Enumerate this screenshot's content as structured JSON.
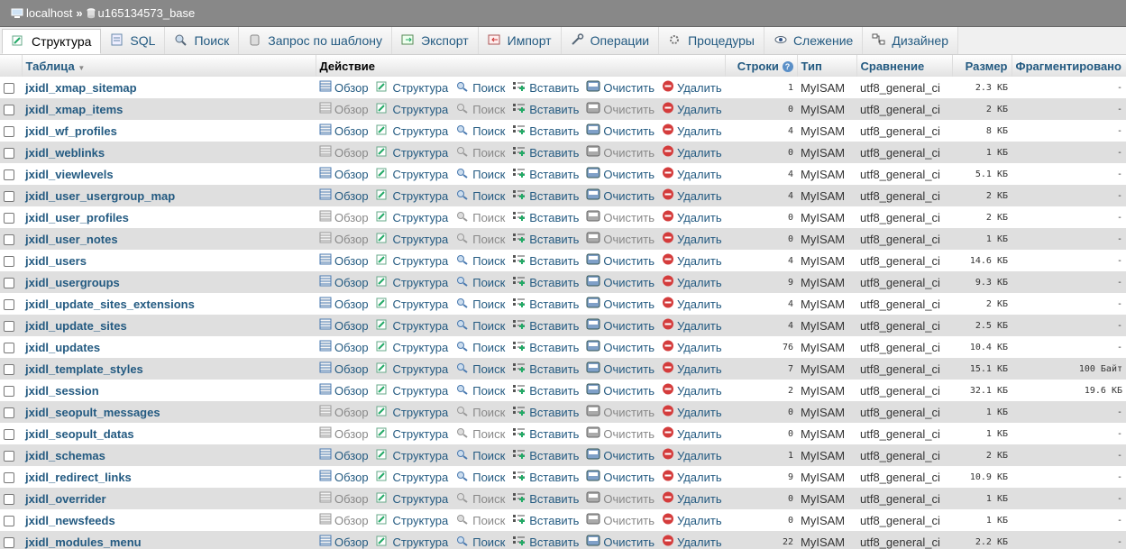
{
  "breadcrumb": {
    "server": "localhost",
    "separator": "»",
    "database": "u165134573_base"
  },
  "tabs": [
    {
      "label": "Структура",
      "icon": "structure-icon",
      "active": true
    },
    {
      "label": "SQL",
      "icon": "sql-icon"
    },
    {
      "label": "Поиск",
      "icon": "search-icon"
    },
    {
      "label": "Запрос по шаблону",
      "icon": "query-icon"
    },
    {
      "label": "Экспорт",
      "icon": "export-icon"
    },
    {
      "label": "Импорт",
      "icon": "import-icon"
    },
    {
      "label": "Операции",
      "icon": "wrench-icon"
    },
    {
      "label": "Процедуры",
      "icon": "routines-icon"
    },
    {
      "label": "Слежение",
      "icon": "eye-icon"
    },
    {
      "label": "Дизайнер",
      "icon": "designer-icon"
    }
  ],
  "headers": {
    "table": "Таблица",
    "action": "Действие",
    "rows": "Строки",
    "type": "Тип",
    "collation": "Сравнение",
    "size": "Размер",
    "overhead": "Фрагментировано"
  },
  "actions": {
    "browse": "Обзор",
    "structure": "Структура",
    "search": "Поиск",
    "insert": "Вставить",
    "empty": "Очистить",
    "drop": "Удалить"
  },
  "tables": [
    {
      "name": "jxidl_xmap_sitemap",
      "rows": "1",
      "type": "MyISAM",
      "collation": "utf8_general_ci",
      "size": "2.3 КБ",
      "overhead": "-",
      "has_rows": true
    },
    {
      "name": "jxidl_xmap_items",
      "rows": "0",
      "type": "MyISAM",
      "collation": "utf8_general_ci",
      "size": "2 КБ",
      "overhead": "-",
      "has_rows": false
    },
    {
      "name": "jxidl_wf_profiles",
      "rows": "4",
      "type": "MyISAM",
      "collation": "utf8_general_ci",
      "size": "8 КБ",
      "overhead": "-",
      "has_rows": true
    },
    {
      "name": "jxidl_weblinks",
      "rows": "0",
      "type": "MyISAM",
      "collation": "utf8_general_ci",
      "size": "1 КБ",
      "overhead": "-",
      "has_rows": false
    },
    {
      "name": "jxidl_viewlevels",
      "rows": "4",
      "type": "MyISAM",
      "collation": "utf8_general_ci",
      "size": "5.1 КБ",
      "overhead": "-",
      "has_rows": true
    },
    {
      "name": "jxidl_user_usergroup_map",
      "rows": "4",
      "type": "MyISAM",
      "collation": "utf8_general_ci",
      "size": "2 КБ",
      "overhead": "-",
      "has_rows": true
    },
    {
      "name": "jxidl_user_profiles",
      "rows": "0",
      "type": "MyISAM",
      "collation": "utf8_general_ci",
      "size": "2 КБ",
      "overhead": "-",
      "has_rows": false
    },
    {
      "name": "jxidl_user_notes",
      "rows": "0",
      "type": "MyISAM",
      "collation": "utf8_general_ci",
      "size": "1 КБ",
      "overhead": "-",
      "has_rows": false
    },
    {
      "name": "jxidl_users",
      "rows": "4",
      "type": "MyISAM",
      "collation": "utf8_general_ci",
      "size": "14.6 КБ",
      "overhead": "-",
      "has_rows": true
    },
    {
      "name": "jxidl_usergroups",
      "rows": "9",
      "type": "MyISAM",
      "collation": "utf8_general_ci",
      "size": "9.3 КБ",
      "overhead": "-",
      "has_rows": true
    },
    {
      "name": "jxidl_update_sites_extensions",
      "rows": "4",
      "type": "MyISAM",
      "collation": "utf8_general_ci",
      "size": "2 КБ",
      "overhead": "-",
      "has_rows": true
    },
    {
      "name": "jxidl_update_sites",
      "rows": "4",
      "type": "MyISAM",
      "collation": "utf8_general_ci",
      "size": "2.5 КБ",
      "overhead": "-",
      "has_rows": true
    },
    {
      "name": "jxidl_updates",
      "rows": "76",
      "type": "MyISAM",
      "collation": "utf8_general_ci",
      "size": "10.4 КБ",
      "overhead": "-",
      "has_rows": true
    },
    {
      "name": "jxidl_template_styles",
      "rows": "7",
      "type": "MyISAM",
      "collation": "utf8_general_ci",
      "size": "15.1 КБ",
      "overhead": "100 Байт",
      "has_rows": true
    },
    {
      "name": "jxidl_session",
      "rows": "2",
      "type": "MyISAM",
      "collation": "utf8_general_ci",
      "size": "32.1 КБ",
      "overhead": "19.6 КБ",
      "has_rows": true
    },
    {
      "name": "jxidl_seopult_messages",
      "rows": "0",
      "type": "MyISAM",
      "collation": "utf8_general_ci",
      "size": "1 КБ",
      "overhead": "-",
      "has_rows": false
    },
    {
      "name": "jxidl_seopult_datas",
      "rows": "0",
      "type": "MyISAM",
      "collation": "utf8_general_ci",
      "size": "1 КБ",
      "overhead": "-",
      "has_rows": false
    },
    {
      "name": "jxidl_schemas",
      "rows": "1",
      "type": "MyISAM",
      "collation": "utf8_general_ci",
      "size": "2 КБ",
      "overhead": "-",
      "has_rows": true
    },
    {
      "name": "jxidl_redirect_links",
      "rows": "9",
      "type": "MyISAM",
      "collation": "utf8_general_ci",
      "size": "10.9 КБ",
      "overhead": "-",
      "has_rows": true
    },
    {
      "name": "jxidl_overrider",
      "rows": "0",
      "type": "MyISAM",
      "collation": "utf8_general_ci",
      "size": "1 КБ",
      "overhead": "-",
      "has_rows": false
    },
    {
      "name": "jxidl_newsfeeds",
      "rows": "0",
      "type": "MyISAM",
      "collation": "utf8_general_ci",
      "size": "1 КБ",
      "overhead": "-",
      "has_rows": false
    },
    {
      "name": "jxidl_modules_menu",
      "rows": "22",
      "type": "MyISAM",
      "collation": "utf8_general_ci",
      "size": "2.2 КБ",
      "overhead": "-",
      "has_rows": true
    }
  ],
  "colors": {
    "link": "#235a81",
    "row_even": "#dfdfdf",
    "drop_red": "#d43c3c"
  }
}
